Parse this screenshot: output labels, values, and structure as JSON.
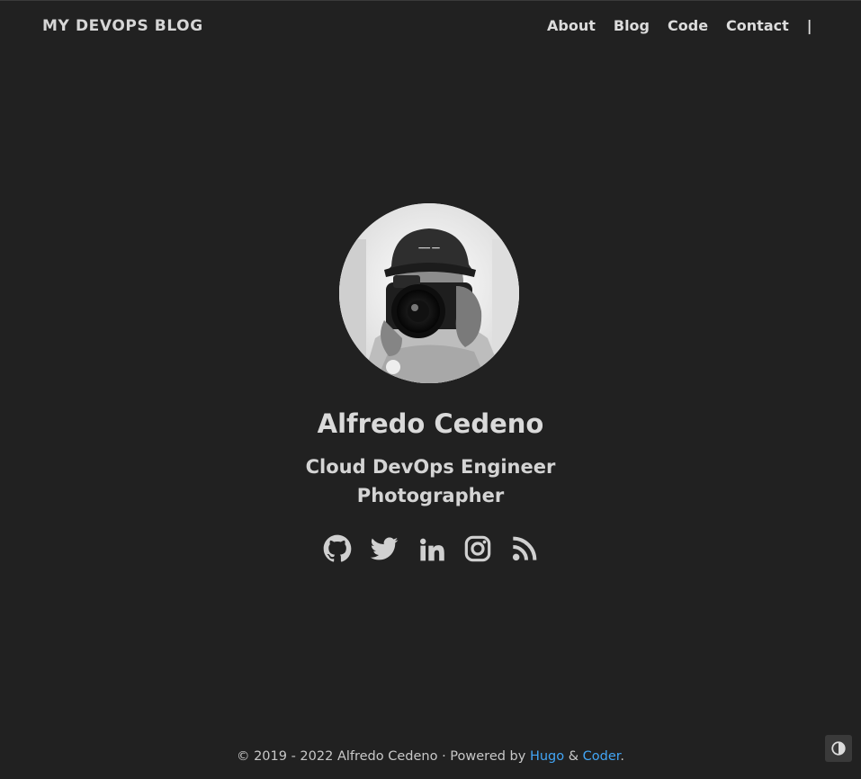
{
  "header": {
    "brand": "MY DEVOPS BLOG",
    "nav": [
      {
        "label": "About"
      },
      {
        "label": "Blog"
      },
      {
        "label": "Code"
      },
      {
        "label": "Contact"
      }
    ],
    "separator": "|"
  },
  "profile": {
    "name": "Alfredo Cedeno",
    "subtitle_lines": [
      "Cloud DevOps Engineer",
      "Photographer"
    ]
  },
  "social": {
    "icons": [
      "github-icon",
      "twitter-icon",
      "linkedin-icon",
      "instagram-icon",
      "rss-icon"
    ]
  },
  "footer": {
    "copyright": "© 2019 - 2022 Alfredo Cedeno · Powered by ",
    "hugo_link": "Hugo",
    "amp": " & ",
    "coder_link": "Coder",
    "period": "."
  },
  "colors": {
    "background": "#212121",
    "text": "#dadada",
    "link": "#42a5f5"
  }
}
